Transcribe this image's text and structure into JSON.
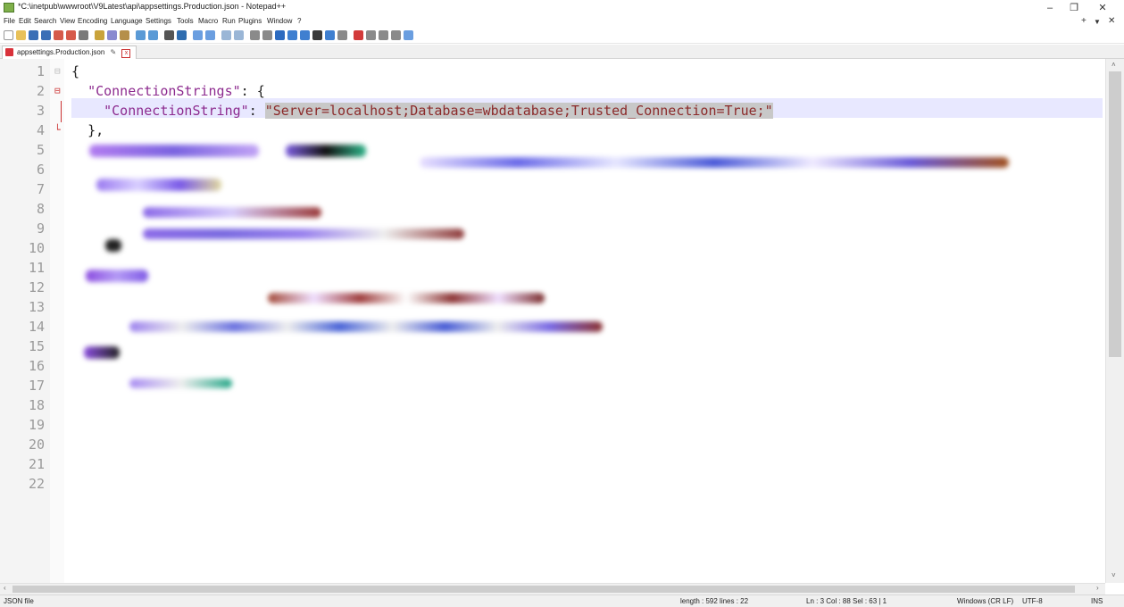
{
  "window": {
    "title": "*C:\\inetpub\\wwwroot\\V9Latest\\api\\appsettings.Production.json - Notepad++",
    "minimize": "–",
    "maximize": "❐",
    "close": "✕"
  },
  "menu": {
    "items": [
      "File",
      "Edit",
      "Search",
      "View",
      "Encoding",
      "Language",
      "Settings",
      "Tools",
      "Macro",
      "Run",
      "Plugins",
      "Window",
      "?"
    ],
    "right_add": "+",
    "right_dropdown": "▼",
    "right_close": "✕"
  },
  "tab": {
    "label": "appsettings.Production.json",
    "pin": "✎",
    "close": "x"
  },
  "editor": {
    "line_numbers": [
      "1",
      "2",
      "3",
      "4",
      "5",
      "6",
      "7",
      "8",
      "9",
      "10",
      "11",
      "12",
      "13",
      "14",
      "15",
      "16",
      "17",
      "18",
      "19",
      "20",
      "21",
      "22"
    ],
    "line1": "{",
    "line2_key": "\"ConnectionStrings\"",
    "line2_rest": ": {",
    "line3_key": "\"ConnectionString\"",
    "line3_colon": ": ",
    "line3_value": "\"Server=localhost;Database=wbdatabase;Trusted_Connection=True;\"",
    "line4": "},"
  },
  "status": {
    "file_type": "JSON file",
    "length_lines": "length : 592   lines : 22",
    "position": "Ln : 3   Col : 88   Sel : 63 | 1",
    "eol": "Windows (CR LF)",
    "encoding": "UTF-8",
    "mode": "INS"
  }
}
